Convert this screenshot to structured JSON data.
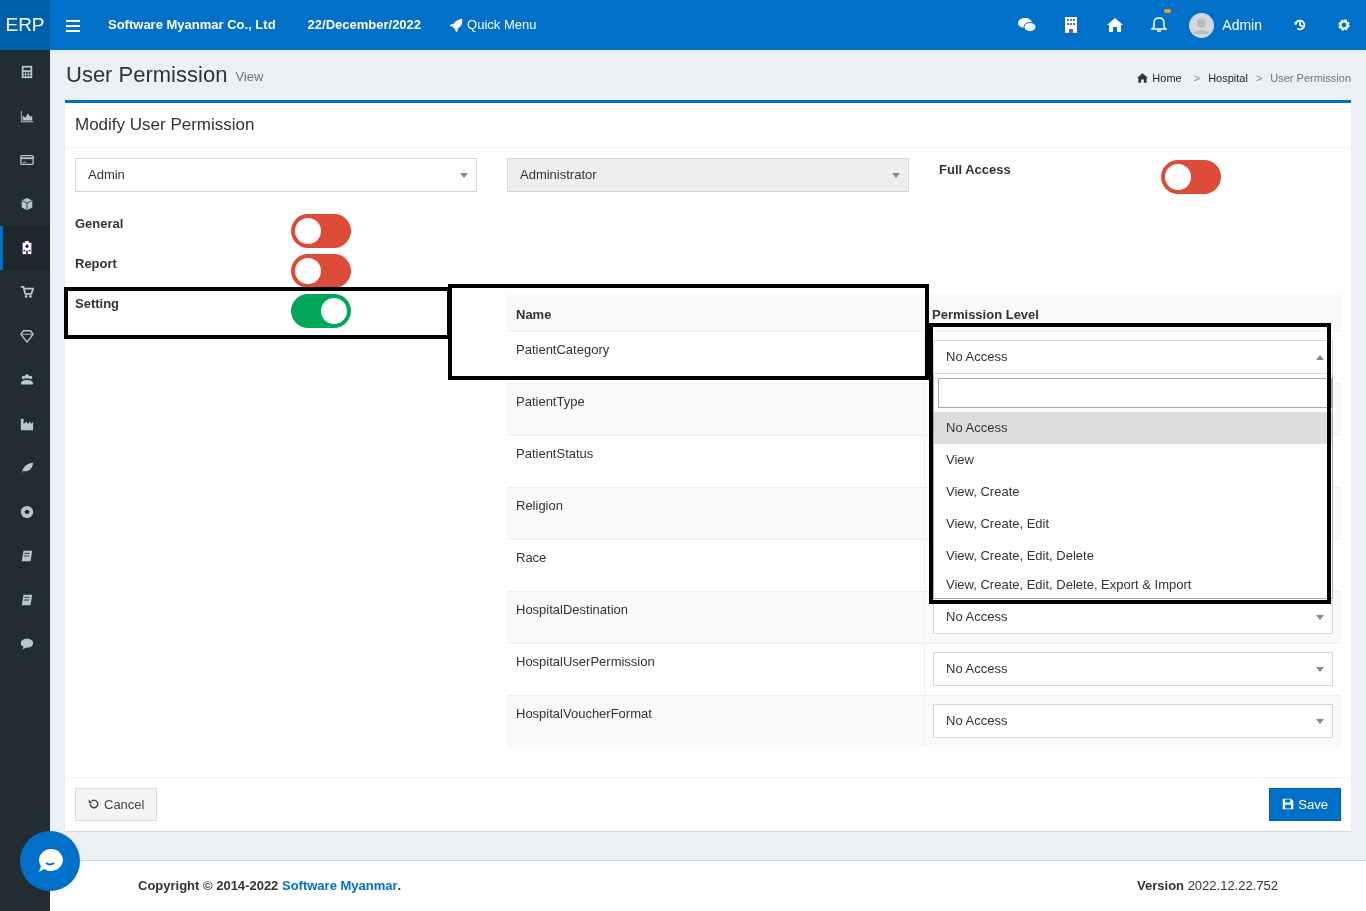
{
  "brand": "ERP",
  "topbar": {
    "company": "Software Myanmar Co., Ltd",
    "date": "22/December/2022",
    "quick_menu": "Quick Menu",
    "user": "Admin",
    "notification_dot": true
  },
  "sidebar": {
    "items": [
      {
        "selected": false
      },
      {
        "selected": false
      },
      {
        "selected": false
      },
      {
        "selected": false
      },
      {
        "selected": true
      },
      {
        "selected": false
      },
      {
        "selected": false
      },
      {
        "selected": false
      },
      {
        "selected": false
      },
      {
        "selected": false
      },
      {
        "selected": false
      },
      {
        "selected": false
      },
      {
        "selected": false
      },
      {
        "selected": false
      }
    ]
  },
  "page": {
    "title": "User Permission",
    "subtitle": "View",
    "breadcrumb": [
      {
        "label": "Home"
      },
      {
        "separator": ">",
        "label": "Hospital"
      },
      {
        "separator": ">",
        "label": "User Permission"
      }
    ]
  },
  "card": {
    "title": "Modify User Permission",
    "user_select": {
      "value": "Admin",
      "disabled": false
    },
    "role_select": {
      "value": "Administrator",
      "disabled": true
    },
    "full_access": {
      "label": "Full Access",
      "on": false
    },
    "groups": [
      {
        "label": "General",
        "on": false
      },
      {
        "label": "Report",
        "on": false
      },
      {
        "label": "Setting",
        "on": true
      }
    ],
    "table": {
      "columns": [
        "Name",
        "Permission Level"
      ],
      "rows": [
        {
          "name": "PatientCategory",
          "permission": "No Access",
          "expanded": true
        },
        {
          "name": "PatientType"
        },
        {
          "name": "PatientStatus"
        },
        {
          "name": "Religion"
        },
        {
          "name": "Race"
        },
        {
          "name": "HospitalDestination",
          "permission": "No Access",
          "expanded": false
        },
        {
          "name": "HospitalUserPermission",
          "permission": "No Access",
          "expanded": false
        },
        {
          "name": "HospitalVoucherFormat",
          "permission": "No Access",
          "expanded": false
        }
      ]
    },
    "dropdown": {
      "options": [
        {
          "label": "No Access",
          "selected": true
        },
        {
          "label": "View",
          "selected": false
        },
        {
          "label": "View, Create",
          "selected": false
        },
        {
          "label": "View, Create, Edit",
          "selected": false
        },
        {
          "label": "View, Create, Edit, Delete",
          "selected": false
        },
        {
          "label": "View, Create, Edit, Delete, Export & Import",
          "selected": false
        }
      ]
    },
    "cancel": "Cancel",
    "save": "Save"
  },
  "footer": {
    "copyright": "Copyright © 2014-2022 **Software Myanmar**.",
    "version_label": "Version",
    "version": "2022.12.22.752"
  }
}
